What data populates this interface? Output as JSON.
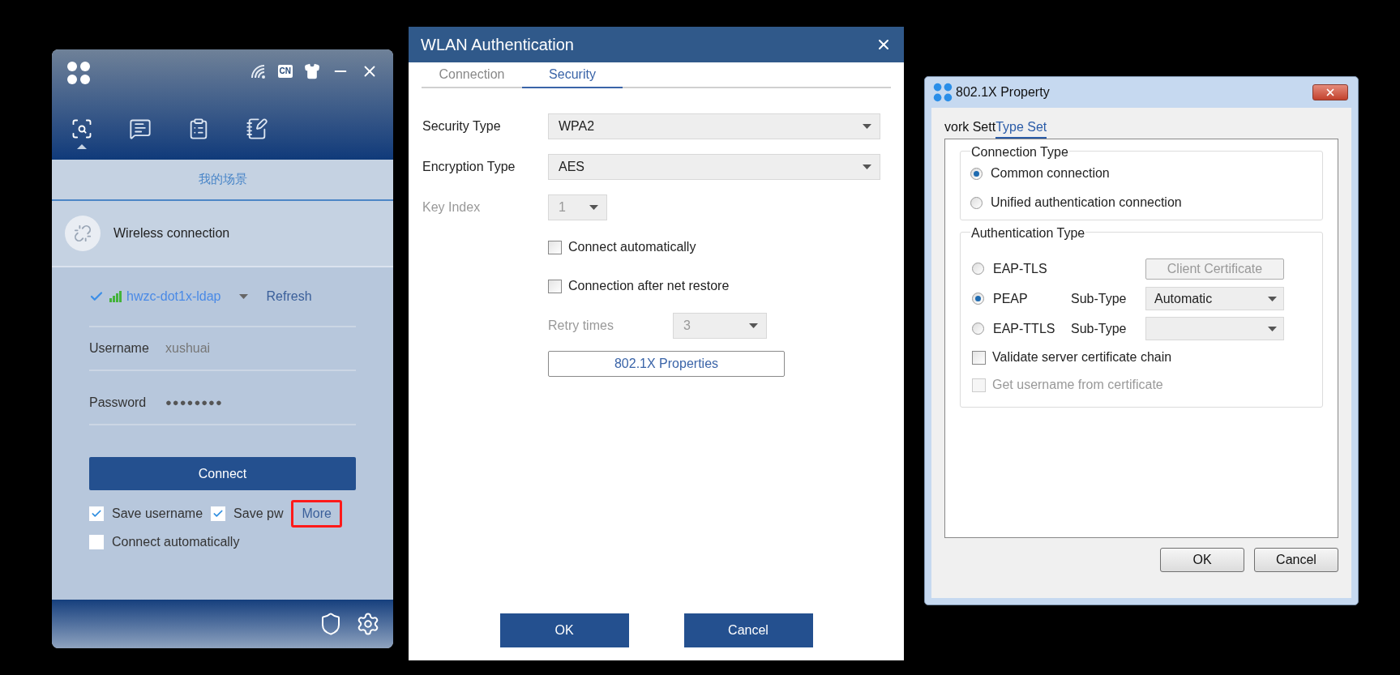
{
  "client_window": {
    "lang_badge": "CN",
    "tabs": [
      {
        "selected": true
      },
      {
        "selected": false
      },
      {
        "selected": false
      },
      {
        "selected": false
      }
    ],
    "scene_title": "我的场景",
    "connection_label": "Wireless connection",
    "network": {
      "name": "hwzc-dot1x-ldap",
      "connected": true
    },
    "refresh": "Refresh",
    "username": {
      "label": "Username",
      "value": "xushuai"
    },
    "password": {
      "label": "Password",
      "value": "●●●●●●●●"
    },
    "connect_button": "Connect",
    "save_options": [
      {
        "label": "Save username",
        "checked": true
      },
      {
        "label": "Save pw",
        "checked": true
      }
    ],
    "more_link": {
      "label": "More",
      "highlighted": true
    },
    "auto_connect": {
      "label": "Connect automatically",
      "checked": false
    }
  },
  "wlan_dialog": {
    "title": "WLAN Authentication",
    "tabs": [
      {
        "label": "Connection",
        "selected": false
      },
      {
        "label": "Security",
        "selected": true
      }
    ],
    "fields": [
      {
        "label": "Security Type",
        "value": "WPA2",
        "disabled": false,
        "kind": "wide"
      },
      {
        "label": "Encryption Type",
        "value": "AES",
        "disabled": false,
        "kind": "wide"
      },
      {
        "label": "Key Index",
        "value": "1",
        "disabled": true,
        "kind": "narrow"
      }
    ],
    "checkboxes": [
      {
        "label": "Connect automatically",
        "checked": false
      },
      {
        "label": "Connection after net restore",
        "checked": false
      }
    ],
    "retry": {
      "label": "Retry times",
      "value": "3",
      "disabled": true
    },
    "properties_button": "802.1X Properties",
    "buttons": [
      "OK",
      "Cancel"
    ]
  },
  "property_dialog": {
    "title": "802.1X Property",
    "tabs": [
      {
        "label": "vork Sett",
        "selected": false
      },
      {
        "label": "Type Set",
        "selected": true
      }
    ],
    "connection_type": {
      "title": "Connection Type",
      "options": [
        {
          "label": "Common connection",
          "selected": true
        },
        {
          "label": "Unified authentication connection",
          "selected": false
        }
      ]
    },
    "authentication_type": {
      "title": "Authentication Type",
      "options": [
        {
          "label": "EAP-TLS",
          "selected": false,
          "kind": "button",
          "control": "Client Certificate",
          "disabled": true
        },
        {
          "label": "PEAP",
          "selected": true,
          "kind": "select",
          "sub_label": "Sub-Type",
          "control": "Automatic"
        },
        {
          "label": "EAP-TTLS",
          "selected": false,
          "kind": "select",
          "sub_label": "Sub-Type"
        }
      ],
      "checkboxes": [
        {
          "label": "Validate server certificate chain",
          "checked": false,
          "disabled": false
        },
        {
          "label": "Get username from certificate",
          "checked": false,
          "disabled": true
        }
      ]
    },
    "buttons": [
      "OK",
      "Cancel"
    ]
  }
}
